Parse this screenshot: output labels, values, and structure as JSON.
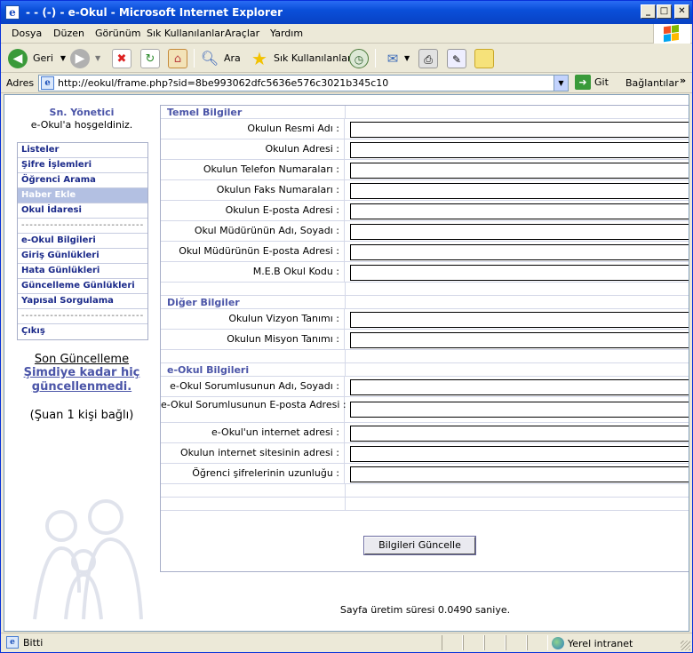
{
  "window": {
    "title": "- - (-) - e-Okul  - Microsoft Internet Explorer",
    "buttons": {
      "minimize": "_",
      "maximize": "□",
      "close": "✕"
    }
  },
  "menubar": {
    "items": [
      "Dosya",
      "Düzen",
      "Görünüm",
      "Sık Kullanılanlar",
      "Araçlar",
      "Yardım"
    ]
  },
  "toolbar": {
    "back_label": "Geri",
    "search_label": "Ara",
    "favorites_label": "Sık Kullanılanlar"
  },
  "address": {
    "label": "Adres",
    "url": "http://eokul/frame.php?sid=8be993062dfc5636e576c3021b345c10",
    "go_label": "Git",
    "links_label": "Bağlantılar",
    "more": "»"
  },
  "sidebar": {
    "user": "Sn. Yönetici",
    "greeting": "e-Okul'a hoşgeldiniz.",
    "menu": [
      {
        "label": "Listeler"
      },
      {
        "label": "Şifre İşlemleri"
      },
      {
        "label": "Öğrenci Arama"
      },
      {
        "label": "Haber Ekle",
        "active": true
      },
      {
        "label": "Okul İdaresi"
      },
      {
        "label": "------------------------------",
        "separator": true
      },
      {
        "label": "e-Okul Bilgileri"
      },
      {
        "label": "Giriş Günlükleri"
      },
      {
        "label": "Hata Günlükleri"
      },
      {
        "label": "Güncelleme Günlükleri"
      },
      {
        "label": "Yapısal Sorgulama"
      },
      {
        "label": "------------------------------",
        "separator": true
      },
      {
        "label": "Çıkış"
      }
    ],
    "last_update_label": "Son Güncelleme",
    "last_update_value": "Şimdiye kadar hiç güncellenmedi.",
    "online": "(Şuan 1 kişi bağlı)"
  },
  "form": {
    "section1_title": "Temel Bilgiler",
    "section1_fields": [
      "Okulun Resmi Adı :",
      "Okulun Adresi :",
      "Okulun Telefon Numaraları :",
      "Okulun Faks Numaraları :",
      "Okulun E-posta Adresi :",
      "Okul Müdürünün Adı, Soyadı :",
      "Okul Müdürünün E-posta Adresi :",
      "M.E.B Okul Kodu :"
    ],
    "section2_title": "Diğer Bilgiler",
    "section2_fields": [
      "Okulun Vizyon Tanımı :",
      "Okulun Misyon Tanımı :"
    ],
    "section3_title": "e-Okul Bilgileri",
    "section3_fields": [
      "e-Okul Sorumlusunun Adı, Soyadı :",
      "e-Okul Sorumlusunun E-posta Adresi :",
      "e-Okul'un internet adresi :",
      "Okulun internet sitesinin adresi :",
      "Öğrenci şifrelerinin uzunluğu :"
    ],
    "submit_label": "Bilgileri Güncelle"
  },
  "footer": {
    "timing": "Sayfa üretim süresi 0.0490 saniye."
  },
  "statusbar": {
    "text": "Bitti",
    "zone": "Yerel intranet"
  }
}
